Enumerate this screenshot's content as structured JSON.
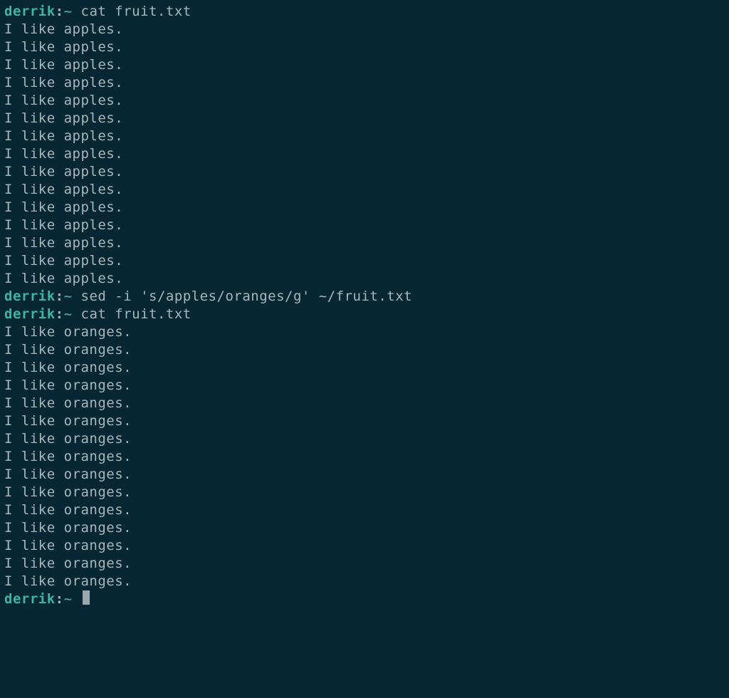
{
  "prompt": {
    "user": "derrik",
    "sep": ":",
    "path": "~",
    "tail": "$ "
  },
  "blocks": [
    {
      "type": "cmd",
      "command": "cat fruit.txt"
    },
    {
      "type": "output",
      "line": "I like apples.",
      "repeat": 15
    },
    {
      "type": "cmd",
      "command": "sed -i 's/apples/oranges/g' ~/fruit.txt"
    },
    {
      "type": "cmd",
      "command": "cat fruit.txt"
    },
    {
      "type": "output",
      "line": "I like oranges.",
      "repeat": 15
    },
    {
      "type": "cmd",
      "command": "",
      "cursor": true
    }
  ]
}
